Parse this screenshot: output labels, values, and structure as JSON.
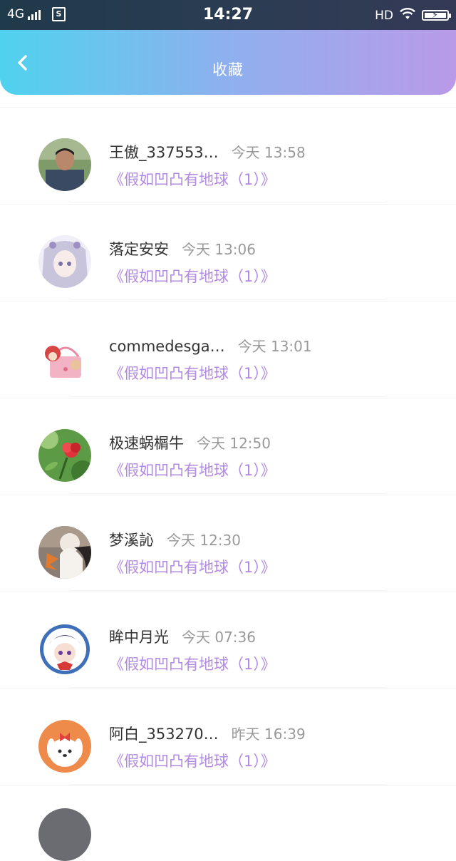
{
  "status_bar": {
    "network": "4G",
    "sim_label": "S",
    "time": "14:27",
    "hd_label": "HD"
  },
  "header": {
    "title": "收藏"
  },
  "favorites": [
    {
      "name": "王傲_337553…",
      "time": "今天 13:58",
      "book": "《假如凹凸有地球（1）》"
    },
    {
      "name": "落定安安",
      "time": "今天 13:06",
      "book": "《假如凹凸有地球（1）》"
    },
    {
      "name": "commedesga…",
      "time": "今天 13:01",
      "book": "《假如凹凸有地球（1）》"
    },
    {
      "name": "极速蜗榍牛",
      "time": "今天 12:50",
      "book": "《假如凹凸有地球（1）》"
    },
    {
      "name": "梦溪訫",
      "time": "今天 12:30",
      "book": "《假如凹凸有地球（1）》"
    },
    {
      "name": "眸中月光",
      "time": "今天 07:36",
      "book": "《假如凹凸有地球（1）》"
    },
    {
      "name": "阿白_353270…",
      "time": "昨天 16:39",
      "book": "《假如凹凸有地球（1）》"
    }
  ],
  "colors": {
    "header_gradient_start": "#4fd2ee",
    "header_gradient_end": "#b99ae8",
    "book_title": "#b28ae0",
    "name_text": "#333333",
    "time_text": "#999999"
  }
}
